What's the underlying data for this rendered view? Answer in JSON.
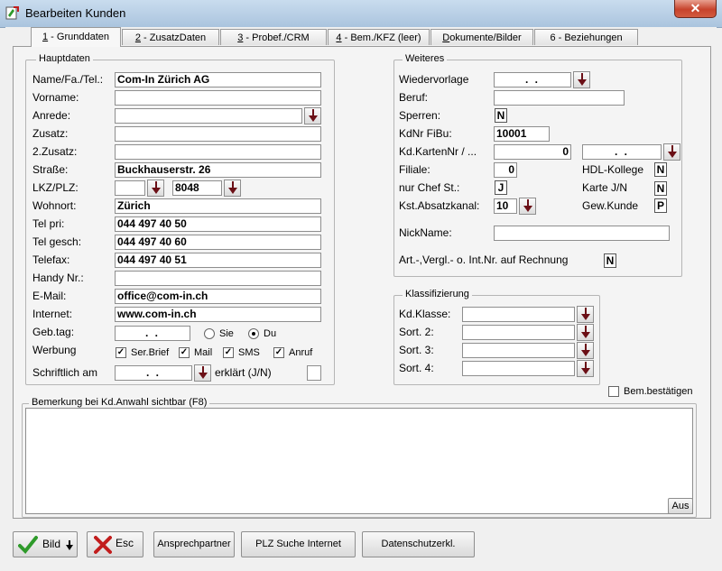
{
  "window": {
    "title": "Bearbeiten Kunden"
  },
  "tabs": [
    {
      "key": "1",
      "label": " - Grunddaten"
    },
    {
      "key": "2",
      "label": " - ZusatzDaten"
    },
    {
      "key": "3",
      "label": " - Probef./CRM"
    },
    {
      "key": "4",
      "label": " - Bem./KFZ (leer)"
    },
    {
      "key": "D",
      "label": "okumente/Bilder"
    },
    {
      "key": "6 - B",
      "label": "eziehungen"
    }
  ],
  "hauptdaten": {
    "legend": "Hauptdaten",
    "name_label": "Name/Fa./Tel.:",
    "name": "Com-In Zürich AG",
    "vorname_label": "Vorname:",
    "vorname": "",
    "anrede_label": "Anrede:",
    "anrede": "",
    "zusatz_label": "Zusatz:",
    "zusatz": "",
    "zusatz2_label": "2.Zusatz:",
    "zusatz2": "",
    "strasse_label": "Straße:",
    "strasse": "Buckhauserstr. 26",
    "lkz_label": "LKZ/PLZ:",
    "lkz": "",
    "plz": "8048",
    "wohnort_label": "Wohnort:",
    "wohnort": "Zürich",
    "telpri_label": "Tel pri:",
    "telpri": "044 497 40 50",
    "telgesch_label": "Tel gesch:",
    "telgesch": "044 497 40 60",
    "telefax_label": "Telefax:",
    "telefax": "044 497 40 51",
    "handy_label": "Handy Nr.:",
    "handy": "",
    "email_label": "E-Mail:",
    "email": "office@com-in.ch",
    "internet_label": "Internet:",
    "internet": "www.com-in.ch",
    "gebtag_label": "Geb.tag:",
    "gebtag": ". .",
    "sie_label": "Sie",
    "du_label": "Du",
    "werbung_label": "Werbung",
    "werbung": [
      {
        "label": "Ser.Brief",
        "checked": "✓"
      },
      {
        "label": "Mail",
        "checked": "✓"
      },
      {
        "label": "SMS",
        "checked": "✓"
      },
      {
        "label": "Anruf",
        "checked": "✓"
      }
    ],
    "schriftlich_label": "Schriftlich am",
    "schriftlich": ". .",
    "erklaert_label": "erklärt (J/N)",
    "erklaert": ""
  },
  "weiteres": {
    "legend": "Weiteres",
    "wiedervorlage_label": "Wiedervorlage",
    "wiedervorlage": ". .",
    "beruf_label": "Beruf:",
    "beruf": "",
    "sperren_label": "Sperren:",
    "sperren": "N",
    "kdnr_label": "KdNr FiBu:",
    "kdnr": "10001",
    "kdkarten_label": "Kd.KartenNr / ...",
    "kdkarten": "0",
    "kdkarten_date": ". .",
    "filiale_label": "Filiale:",
    "filiale": "0",
    "hdl_label": "HDL-Kollege",
    "hdl": "N",
    "chef_label": "nur Chef St.:",
    "chef": "J",
    "karte_label": "Karte J/N",
    "karte": "N",
    "kst_label": "Kst.Absatzkanal:",
    "kst": "10",
    "gew_label": "Gew.Kunde",
    "gew": "P",
    "nick_label": "NickName:",
    "nick": "",
    "art_label": "Art.-,Vergl.- o. Int.Nr. auf Rechnung",
    "art": "N"
  },
  "klassifizierung": {
    "legend": "Klassifizierung",
    "items": [
      {
        "label": "Kd.Klasse:",
        "value": ""
      },
      {
        "label": "Sort. 2:",
        "value": ""
      },
      {
        "label": "Sort. 3:",
        "value": ""
      },
      {
        "label": "Sort. 4:",
        "value": ""
      }
    ]
  },
  "bem_bestaetigen": "Bem.bestätigen",
  "bemerkung": {
    "legend": "Bemerkung bei Kd.Anwahl sichtbar (F8)",
    "value": "",
    "aus_label": "Aus"
  },
  "buttons": {
    "bild": "Bild",
    "esc": "Esc",
    "ansprech": "Ansprechpartner",
    "plz_suche": "PLZ Suche Internet",
    "datenschutz": "Datenschutzerkl."
  },
  "colors": {
    "arrow": "#6b0f16",
    "check_green": "#2e9a2a",
    "x_red": "#c21d1d"
  }
}
